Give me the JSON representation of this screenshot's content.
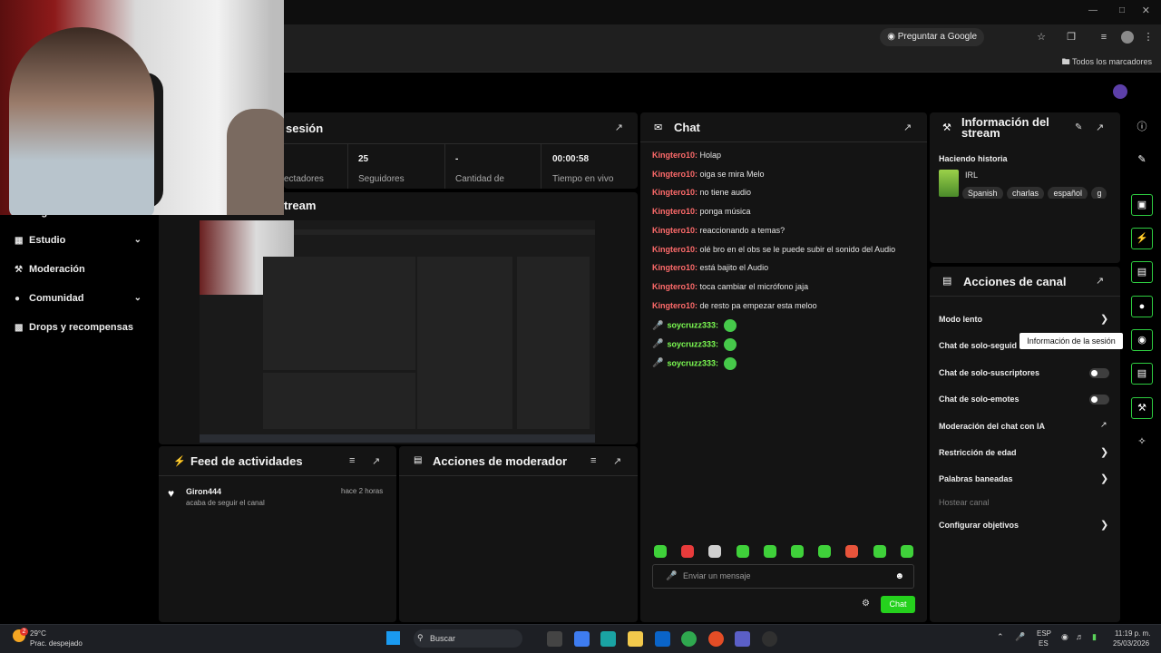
{
  "browser": {
    "ask_google": "Preguntar a Google",
    "bookmarks_label": "Todos los marcadores",
    "icons": [
      "star-icon",
      "extensions-icon",
      "menu-icon",
      "profile-icon",
      "more-icon"
    ]
  },
  "session_panel": {
    "title": "sesión",
    "stats": [
      {
        "value": "",
        "label": "ectadores"
      },
      {
        "value": "25",
        "label": "Seguidores"
      },
      {
        "value": "-",
        "label": "Cantidad de"
      },
      {
        "value": "00:00:58",
        "label": "Tiempo en vivo"
      }
    ]
  },
  "stream_preview": {
    "title": "tream"
  },
  "sidebar": {
    "items": [
      {
        "label": "Logros",
        "icon": "trophy-icon",
        "expandable": false
      },
      {
        "label": "Estudio",
        "icon": "studio-icon",
        "expandable": true
      },
      {
        "label": "Moderación",
        "icon": "wrench-icon",
        "expandable": false
      },
      {
        "label": "Comunidad",
        "icon": "community-icon",
        "expandable": true
      },
      {
        "label": "Drops y recompensas",
        "icon": "drops-icon",
        "expandable": false
      }
    ]
  },
  "activity_feed": {
    "title": "Feed de actividades",
    "items": [
      {
        "user": "Giron444",
        "text": "acaba de seguir el canal",
        "time": "hace 2 horas"
      }
    ]
  },
  "mod_actions": {
    "title": "Acciones de moderador"
  },
  "chat": {
    "title": "Chat",
    "messages": [
      {
        "user": "Kingtero10",
        "text": "Holap",
        "mic": false
      },
      {
        "user": "Kingtero10",
        "text": "oiga se mira Melo",
        "mic": false
      },
      {
        "user": "Kingtero10",
        "text": "no tiene audio",
        "mic": false
      },
      {
        "user": "Kingtero10",
        "text": "ponga música",
        "mic": false
      },
      {
        "user": "Kingtero10",
        "text": "reaccionando a temas?",
        "mic": false
      },
      {
        "user": "Kingtero10",
        "text": "olé bro en el obs se le puede subir el sonido del Audio",
        "mic": false
      },
      {
        "user": "Kingtero10",
        "text": "está bajito el Audio",
        "mic": false
      },
      {
        "user": "Kingtero10",
        "text": "toca cambiar el micrófono jaja",
        "mic": false
      },
      {
        "user": "Kingtero10",
        "text": "de resto pa empezar esta meloo",
        "mic": false
      },
      {
        "user": "soycruzz333",
        "text": "",
        "mic": true
      },
      {
        "user": "soycruzz333",
        "text": "",
        "mic": true
      },
      {
        "user": "soycruzz333",
        "text": "",
        "mic": true
      }
    ],
    "input_placeholder": "Enviar un mensaje",
    "send_label": "Chat"
  },
  "stream_info": {
    "title_line1": "Información del",
    "title_line2": "stream",
    "stream_title": "Haciendo historia",
    "category": "IRL",
    "tags": [
      "Spanish",
      "charlas",
      "español",
      "g"
    ]
  },
  "channel_actions": {
    "title": "Acciones de canal",
    "rows": [
      {
        "label": "Modo lento",
        "control": "chevron"
      },
      {
        "label": "Chat de solo-seguid",
        "control": "none"
      },
      {
        "label": "Chat de solo-suscriptores",
        "control": "toggle"
      },
      {
        "label": "Chat de solo-emotes",
        "control": "toggle"
      },
      {
        "label": "Moderación del chat con IA",
        "control": "external"
      },
      {
        "label": "Restricción de edad",
        "control": "chevron"
      },
      {
        "label": "Palabras baneadas",
        "control": "chevron"
      },
      {
        "label": "Hostear canal",
        "control": "disabled"
      },
      {
        "label": "Configurar objetivos",
        "control": "chevron"
      }
    ],
    "tooltip": "Información de la sesión"
  },
  "taskbar": {
    "weather_temp": "29°C",
    "weather_desc": "Prac. despejado",
    "weather_badge": "2",
    "search_label": "Buscar",
    "lang_line1": "ESP",
    "lang_line2": "ES",
    "time": "11:19 p. m.",
    "date": "25/03/2026"
  },
  "colors": {
    "accent": "#25d11d",
    "chat_user": "#ff6b6b",
    "mic_user": "#7dff53",
    "panel": "#141414"
  }
}
